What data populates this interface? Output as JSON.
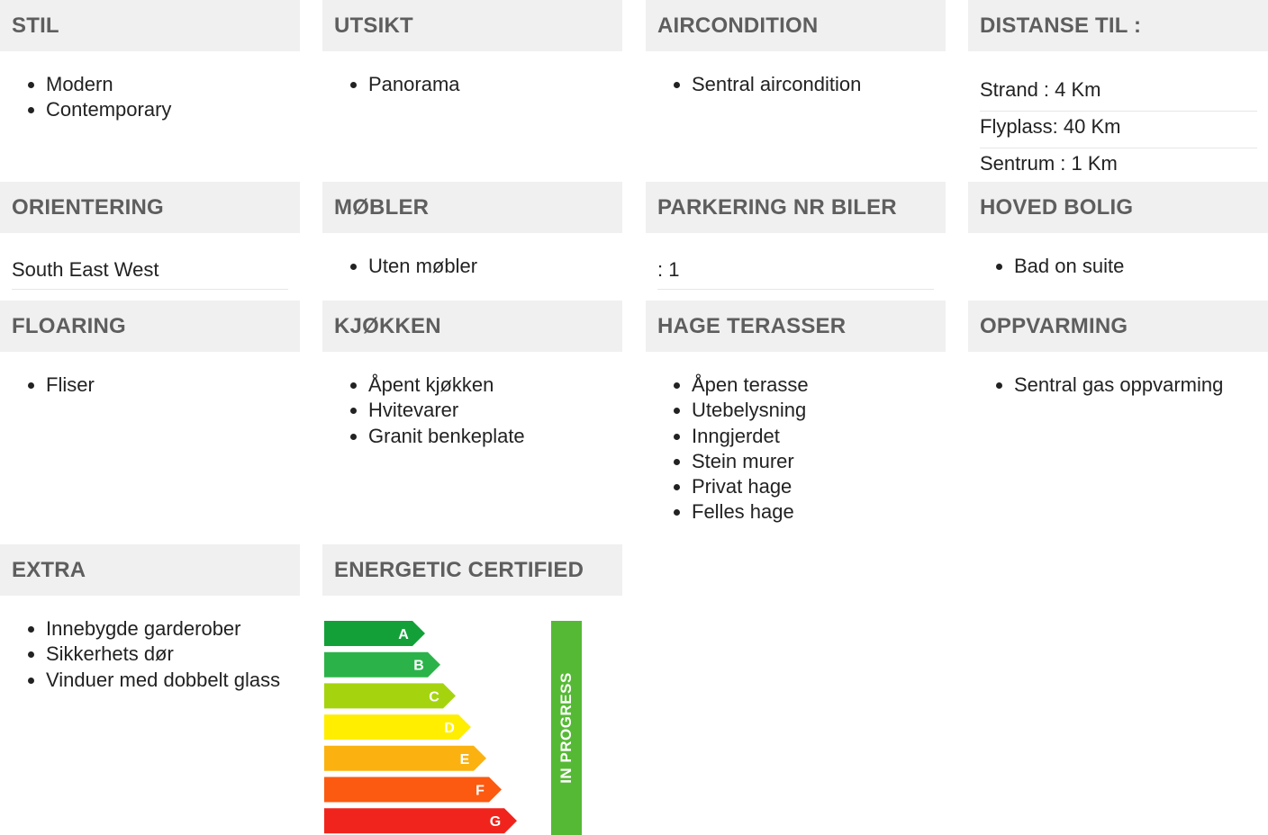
{
  "sections": {
    "stil": {
      "title": "STIL",
      "items": [
        "Modern",
        "Contemporary"
      ]
    },
    "utsikt": {
      "title": "UTSIKT",
      "items": [
        "Panorama"
      ]
    },
    "aircondition": {
      "title": "AIRCONDITION",
      "items": [
        "Sentral aircondition"
      ]
    },
    "distanse": {
      "title": "DISTANSE TIL :",
      "rows": [
        "Strand : 4 Km",
        "Flyplass: 40 Km",
        "Sentrum : 1 Km"
      ]
    },
    "orientering": {
      "title": "ORIENTERING",
      "value": "South East West"
    },
    "mobler": {
      "title": "MØBLER",
      "items": [
        "Uten møbler"
      ]
    },
    "parkering": {
      "title": "PARKERING NR BILER",
      "value": ": 1"
    },
    "hoved_bolig": {
      "title": "HOVED BOLIG",
      "items": [
        "Bad on suite"
      ]
    },
    "floaring": {
      "title": "FLOARING",
      "items": [
        "Fliser"
      ]
    },
    "kjokken": {
      "title": "KJØKKEN",
      "items": [
        "Åpent kjøkken",
        "Hvitevarer",
        "Granit benkeplate"
      ]
    },
    "hage": {
      "title": "HAGE TERASSER",
      "items": [
        "Åpen terasse",
        "Utebelysning",
        "Inngjerdet",
        "Stein murer",
        "Privat hage",
        "Felles hage"
      ]
    },
    "oppvarming": {
      "title": "OPPVARMING",
      "items": [
        "Sentral gas oppvarming"
      ]
    },
    "extra": {
      "title": "EXTRA",
      "items": [
        "Innebygde garderober",
        "Sikkerhets dør",
        "Vinduer med dobbelt glass"
      ]
    },
    "energetic": {
      "title": "ENERGETIC CERTIFIED"
    }
  },
  "energy": {
    "classes": [
      "A",
      "B",
      "C",
      "D",
      "E",
      "F",
      "G"
    ],
    "colors": [
      "#13a039",
      "#2bb34a",
      "#a5d40e",
      "#ffee00",
      "#fbb210",
      "#fb5a10",
      "#f0241c"
    ],
    "status": "IN PROGRESS",
    "status_color": "#56b935"
  }
}
